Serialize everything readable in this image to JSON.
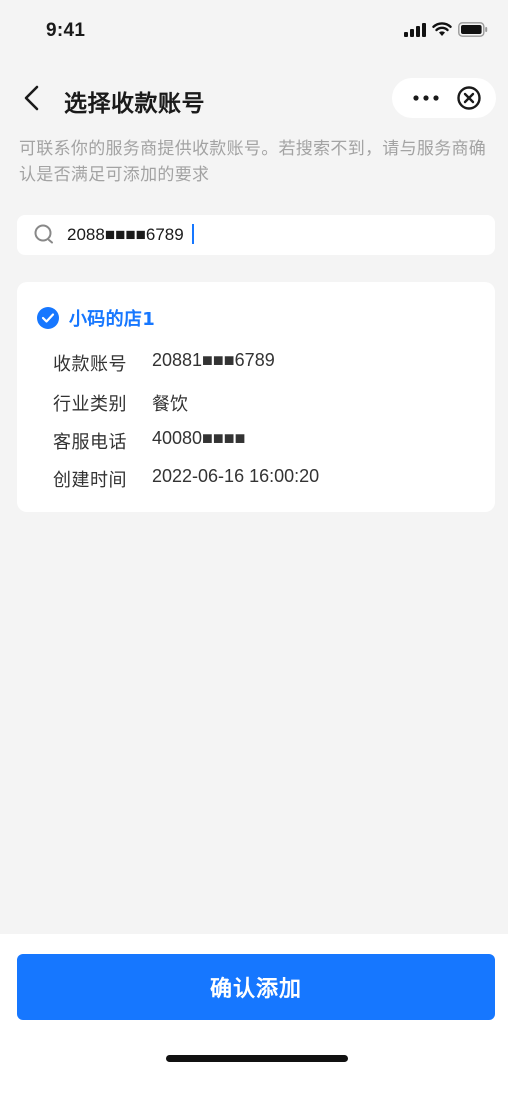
{
  "status_bar": {
    "time": "9:41",
    "icons": [
      "cellular-signal-icon",
      "wifi-icon",
      "battery-icon"
    ]
  },
  "nav": {
    "title": "选择收款账号",
    "back_icon": "chevron-left-icon",
    "more_icon": "more-dots-icon",
    "close_icon": "close-circle-icon"
  },
  "description": "可联系你的服务商提供收款账号。若搜索不到，请与服务商确认是否满足可添加的要求",
  "search": {
    "value": "2088■■■■6789",
    "icon": "search-icon"
  },
  "result": {
    "selected": true,
    "store_name": "小码的店1",
    "rows": [
      {
        "label": "收款账号",
        "value": "20881■■■6789"
      },
      {
        "label": "行业类别",
        "value": "餐饮"
      },
      {
        "label": "客服电话",
        "value": "40080■■■■"
      },
      {
        "label": "创建时间",
        "value": "2022-06-16 16:00:20"
      }
    ]
  },
  "confirm_button": "确认添加",
  "colors": {
    "accent": "#1677ff",
    "background": "#f4f4f4",
    "card": "#ffffff",
    "description_text": "#a3a3a3"
  }
}
